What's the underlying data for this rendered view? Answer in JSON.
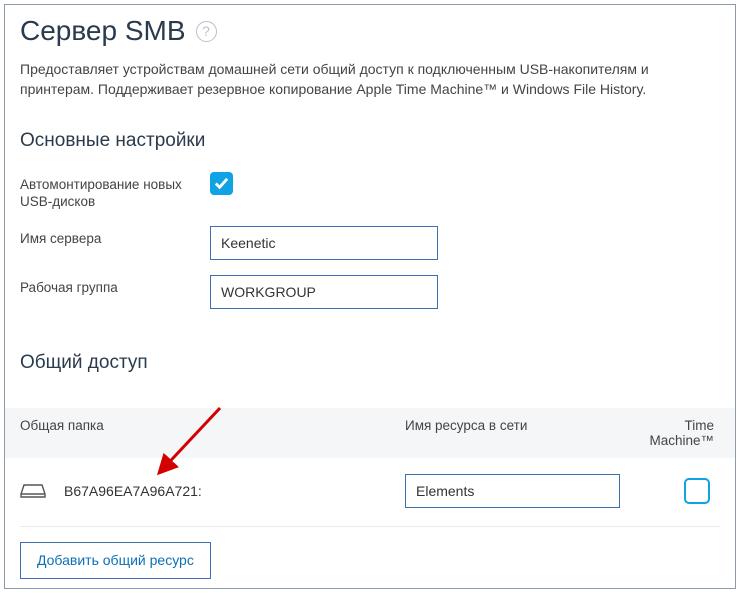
{
  "header": {
    "title": "Сервер SMB",
    "help_symbol": "?"
  },
  "description": "Предоставляет устройствам домашней сети общий доступ к подключенным USB-накопителям и принтерам. Поддерживает резервное копирование Apple Time Machine™ и Windows File History.",
  "sections": {
    "basic": {
      "title": "Основные настройки",
      "automount_label": "Автомонтирование новых USB-дисков",
      "automount_checked": true,
      "server_name_label": "Имя сервера",
      "server_name_value": "Keenetic",
      "workgroup_label": "Рабочая группа",
      "workgroup_value": "WORKGROUP"
    },
    "shares": {
      "title": "Общий доступ",
      "columns": {
        "folder": "Общая папка",
        "resource": "Имя ресурса в сети",
        "time_machine": "Time Machine™"
      },
      "rows": [
        {
          "folder_name": "B67A96EA7A96A721:",
          "resource_name": "Elements",
          "time_machine_checked": false
        }
      ],
      "add_button": "Добавить общий ресурс"
    }
  }
}
